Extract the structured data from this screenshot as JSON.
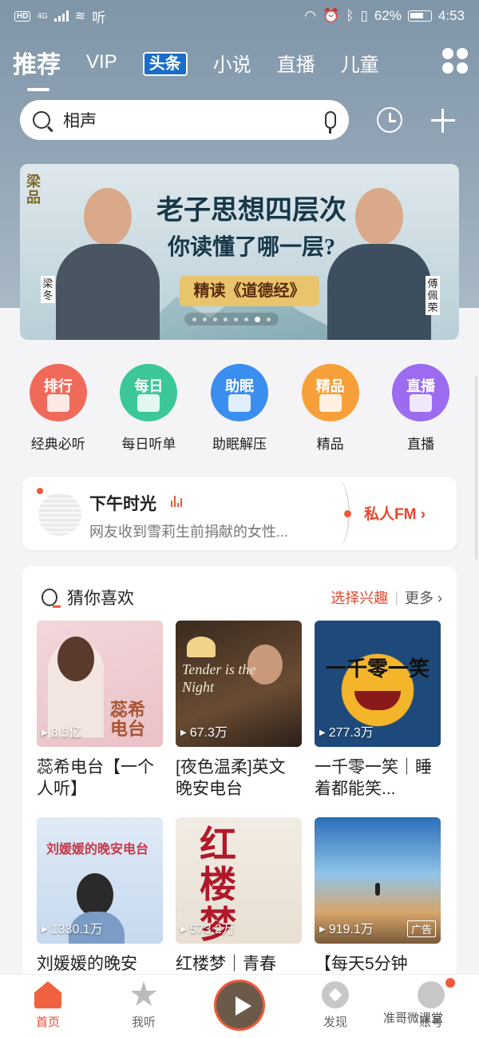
{
  "status_bar": {
    "hd": "HD",
    "network": "4G",
    "app_name": "听",
    "battery": "62%",
    "time": "4:53"
  },
  "tabs": [
    {
      "label": "推荐",
      "active": true
    },
    {
      "label": "VIP"
    },
    {
      "label": "头条",
      "badge": true
    },
    {
      "label": "小说"
    },
    {
      "label": "直播"
    },
    {
      "label": "儿童"
    }
  ],
  "search": {
    "placeholder": "相声"
  },
  "banner": {
    "logo": "梁品",
    "title_line1": "老子思想四层次",
    "title_line2": "你读懂了哪一层?",
    "scroll_text": "精读《道德经》",
    "left_name": "梁冬",
    "right_name": "傅佩荣",
    "dot_count": 8,
    "active_dot": 6
  },
  "categories": [
    {
      "icon_text": "排行",
      "label": "经典必听",
      "color": "#f06a5a",
      "icon": "trophy-icon"
    },
    {
      "icon_text": "每日",
      "label": "每日听单",
      "color": "#3cc796",
      "icon": "calendar-icon"
    },
    {
      "icon_text": "助眠",
      "label": "助眠解压",
      "color": "#3a8ef0",
      "icon": "moon-icon"
    },
    {
      "icon_text": "精品",
      "label": "精品",
      "color": "#f7a03a",
      "icon": "crown-icon"
    },
    {
      "icon_text": "直播",
      "label": "直播",
      "color": "#9b6cf0",
      "icon": "video-icon"
    }
  ],
  "fm": {
    "title": "下午时光",
    "subtitle": "网友收到雪莉生前捐献的女性...",
    "link": "私人FM ›"
  },
  "guess": {
    "title": "猜你喜欢",
    "interest": "选择兴趣",
    "separator": "|",
    "more": "更多 ›",
    "items": [
      {
        "title": "蕊希电台【一个人听】",
        "count": "8.5亿",
        "overlay": "蕊希电台"
      },
      {
        "title": "[夜色温柔]英文晚安电台",
        "count": "67.3万",
        "overlay": "Tender is the Night"
      },
      {
        "title": "一千零一笑｜睡着都能笑...",
        "count": "277.3万",
        "overlay": "一千零一笑"
      },
      {
        "title": "刘媛媛的晚安",
        "count": "1330.1万",
        "overlay": "刘媛媛的晚安电台"
      },
      {
        "title": "红楼梦｜青春",
        "count": "573.2万",
        "overlay": "红楼梦"
      },
      {
        "title": "【每天5分钟",
        "count": "919.1万",
        "overlay": "广告"
      }
    ]
  },
  "bottom_nav": [
    {
      "label": "首页",
      "active": true
    },
    {
      "label": "我听"
    },
    {
      "label": ""
    },
    {
      "label": "发现"
    },
    {
      "label": "账号"
    }
  ],
  "watermark": "准哥微课堂"
}
